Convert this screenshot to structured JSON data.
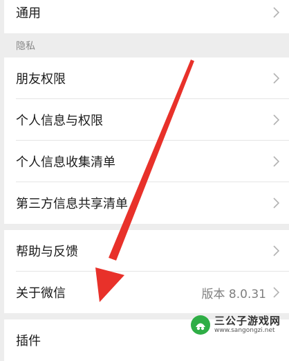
{
  "settings": {
    "general": {
      "label": "通用"
    },
    "privacy_header": "隐私",
    "privacy_items": [
      {
        "label": "朋友权限"
      },
      {
        "label": "个人信息与权限"
      },
      {
        "label": "个人信息收集清单"
      },
      {
        "label": "第三方信息共享清单"
      }
    ],
    "help": {
      "label": "帮助与反馈"
    },
    "about": {
      "label": "关于微信",
      "value": "版本 8.0.31"
    },
    "plugins": {
      "label": "插件"
    }
  },
  "watermark": {
    "title": "三公子游戏网",
    "url": "www.sangongzi.net"
  },
  "colors": {
    "arrow": "#e8312a",
    "background": "#ededed",
    "row_bg": "#ffffff"
  }
}
